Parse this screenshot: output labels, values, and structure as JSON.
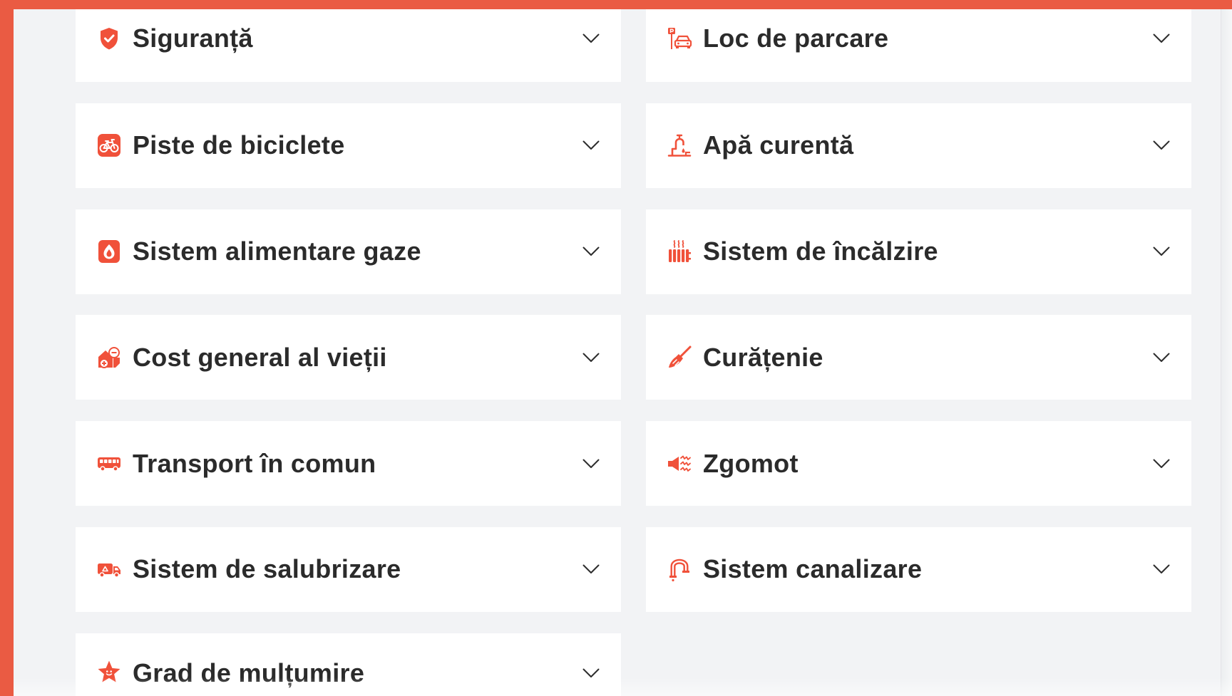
{
  "colors": {
    "accent": "#ea5b43",
    "icon": "#f0513a",
    "text": "#2b2b2b",
    "background": "#f2f3f5",
    "card": "#ffffff",
    "chevron": "#2d2d2d"
  },
  "accordion": {
    "items": [
      {
        "label": "Siguranță",
        "icon": "shield-check-icon"
      },
      {
        "label": "Loc de parcare",
        "icon": "parking-car-icon"
      },
      {
        "label": "Piste de biciclete",
        "icon": "bicycle-icon"
      },
      {
        "label": "Apă curentă",
        "icon": "water-tap-icon"
      },
      {
        "label": "Sistem alimentare gaze",
        "icon": "gas-flame-icon"
      },
      {
        "label": "Sistem de încălzire",
        "icon": "radiator-icon"
      },
      {
        "label": "Cost general al vieții",
        "icon": "cost-of-living-icon"
      },
      {
        "label": "Curățenie",
        "icon": "broom-icon"
      },
      {
        "label": "Transport în comun",
        "icon": "bus-icon"
      },
      {
        "label": "Zgomot",
        "icon": "noise-megaphone-icon"
      },
      {
        "label": "Sistem de salubrizare",
        "icon": "garbage-truck-icon"
      },
      {
        "label": "Sistem canalizare",
        "icon": "sewer-pipe-icon"
      },
      {
        "label": "Grad de mulțumire",
        "icon": "star-smile-icon"
      }
    ]
  }
}
